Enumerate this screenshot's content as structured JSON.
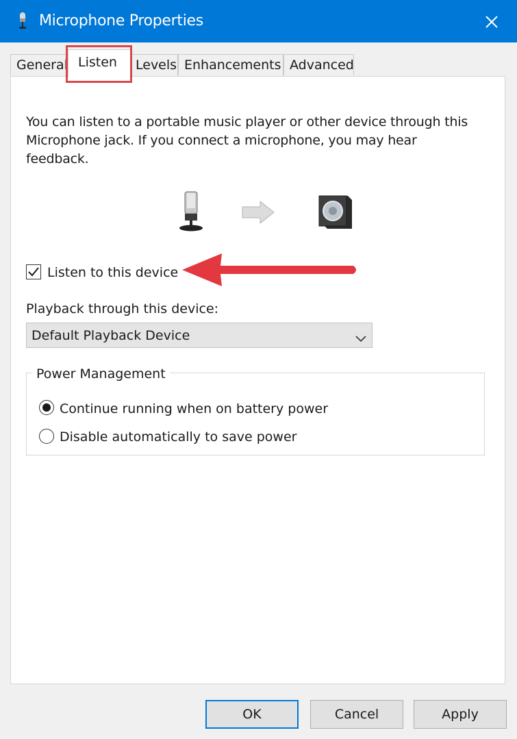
{
  "window": {
    "title": "Microphone Properties",
    "title_icon": "microphone-icon",
    "close_icon": "close-icon"
  },
  "tabs": [
    {
      "label": "General",
      "active": false
    },
    {
      "label": "Listen",
      "active": true
    },
    {
      "label": "Levels",
      "active": false
    },
    {
      "label": "Enhancements",
      "active": false
    },
    {
      "label": "Advanced",
      "active": false
    }
  ],
  "listen": {
    "description_line1": "You can listen to a portable music player or other device through this",
    "description_line2": "Microphone jack.  If you connect a microphone, you may hear",
    "description_line3": "feedback.",
    "listen_checkbox_label": "Listen to this device",
    "listen_checked": true,
    "playback_label": "Playback through this device:",
    "playback_device": "Default Playback Device"
  },
  "power": {
    "legend": "Power Management",
    "options": [
      {
        "label": "Continue running when on battery power",
        "selected": true
      },
      {
        "label": "Disable automatically to save power",
        "selected": false
      }
    ]
  },
  "buttons": {
    "ok": "OK",
    "cancel": "Cancel",
    "apply": "Apply"
  },
  "colors": {
    "titlebar": "#0078d7",
    "annotation_red": "#e2383f",
    "highlight_border": "#d9474e"
  }
}
